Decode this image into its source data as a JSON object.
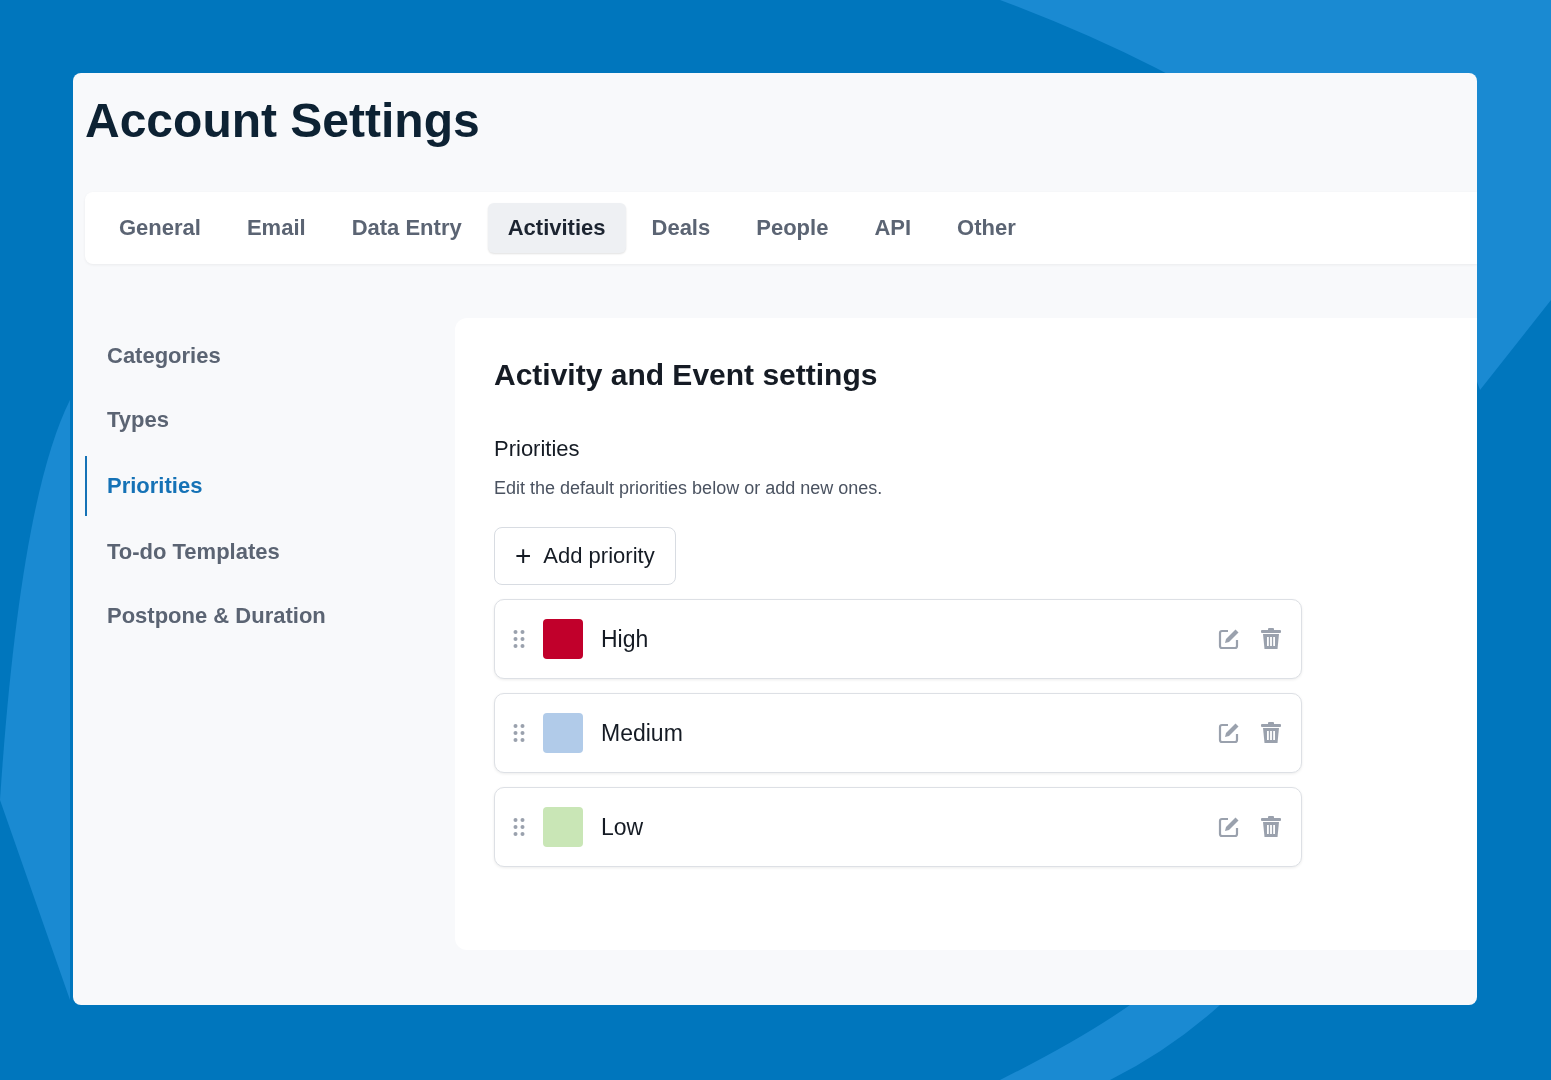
{
  "page": {
    "title": "Account Settings"
  },
  "tabs": [
    {
      "label": "General",
      "selected": false
    },
    {
      "label": "Email",
      "selected": false
    },
    {
      "label": "Data Entry",
      "selected": false
    },
    {
      "label": "Activities",
      "selected": true
    },
    {
      "label": "Deals",
      "selected": false
    },
    {
      "label": "People",
      "selected": false
    },
    {
      "label": "API",
      "selected": false
    },
    {
      "label": "Other",
      "selected": false
    }
  ],
  "sidebar": {
    "items": [
      {
        "label": "Categories",
        "selected": false
      },
      {
        "label": "Types",
        "selected": false
      },
      {
        "label": "Priorities",
        "selected": true
      },
      {
        "label": "To-do Templates",
        "selected": false
      },
      {
        "label": "Postpone & Duration",
        "selected": false
      }
    ]
  },
  "panel": {
    "heading": "Activity and Event settings",
    "section_title": "Priorities",
    "description": "Edit the default priorities below or add new ones.",
    "add_button": {
      "icon": "+",
      "label": "Add priority"
    },
    "priorities": [
      {
        "name": "High",
        "color": "#c1002b"
      },
      {
        "name": "Medium",
        "color": "#b1cbe9"
      },
      {
        "name": "Low",
        "color": "#c9e6b6"
      }
    ]
  }
}
